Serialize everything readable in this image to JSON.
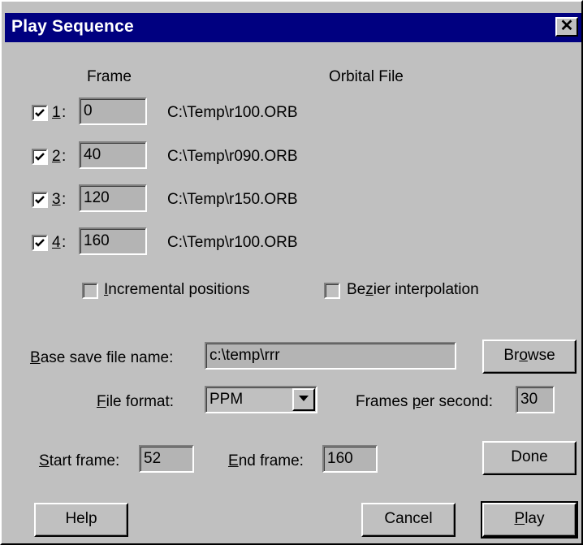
{
  "window": {
    "title": "Play Sequence",
    "close_glyph": "✕"
  },
  "headers": {
    "frame": "Frame",
    "orbital_file": "Orbital File"
  },
  "rows": [
    {
      "num": "1",
      "checked": true,
      "frame": "0",
      "file": "C:\\Temp\\r100.ORB"
    },
    {
      "num": "2",
      "checked": true,
      "frame": "40",
      "file": "C:\\Temp\\r090.ORB"
    },
    {
      "num": "3",
      "checked": true,
      "frame": "120",
      "file": "C:\\Temp\\r150.ORB"
    },
    {
      "num": "4",
      "checked": true,
      "frame": "160",
      "file": "C:\\Temp\\r100.ORB"
    }
  ],
  "options": {
    "incremental": {
      "label_u": "I",
      "label_rest": "ncremental positions",
      "checked": false
    },
    "bezier": {
      "label_pre": "Be",
      "label_u": "z",
      "label_rest": "ier interpolation",
      "checked": false
    }
  },
  "save": {
    "label_u": "B",
    "label_rest": "ase save file name:",
    "value": "c:\\temp\\rrr",
    "browse_pre": "Br",
    "browse_u": "o",
    "browse_rest": "wse"
  },
  "format": {
    "label_u": "F",
    "label_rest": "ile format:",
    "value": "PPM",
    "fps_pre": "Frames ",
    "fps_u": "p",
    "fps_rest": "er second:",
    "fps_value": "30"
  },
  "range": {
    "start_u": "S",
    "start_rest": "tart frame:",
    "start_value": "52",
    "end_u": "E",
    "end_rest": "nd frame:",
    "end_value": "160"
  },
  "buttons": {
    "done": "Done",
    "help": "Help",
    "cancel": "Cancel",
    "play_u": "P",
    "play_rest": "lay"
  },
  "icons": {
    "checkbox_check": "checkmark-icon",
    "dropdown": "chevron-down-icon",
    "close": "close-icon"
  },
  "colors": {
    "title_bg": "#000080",
    "face": "#c0c0c0",
    "disabled_field": "#b4b4b4"
  }
}
